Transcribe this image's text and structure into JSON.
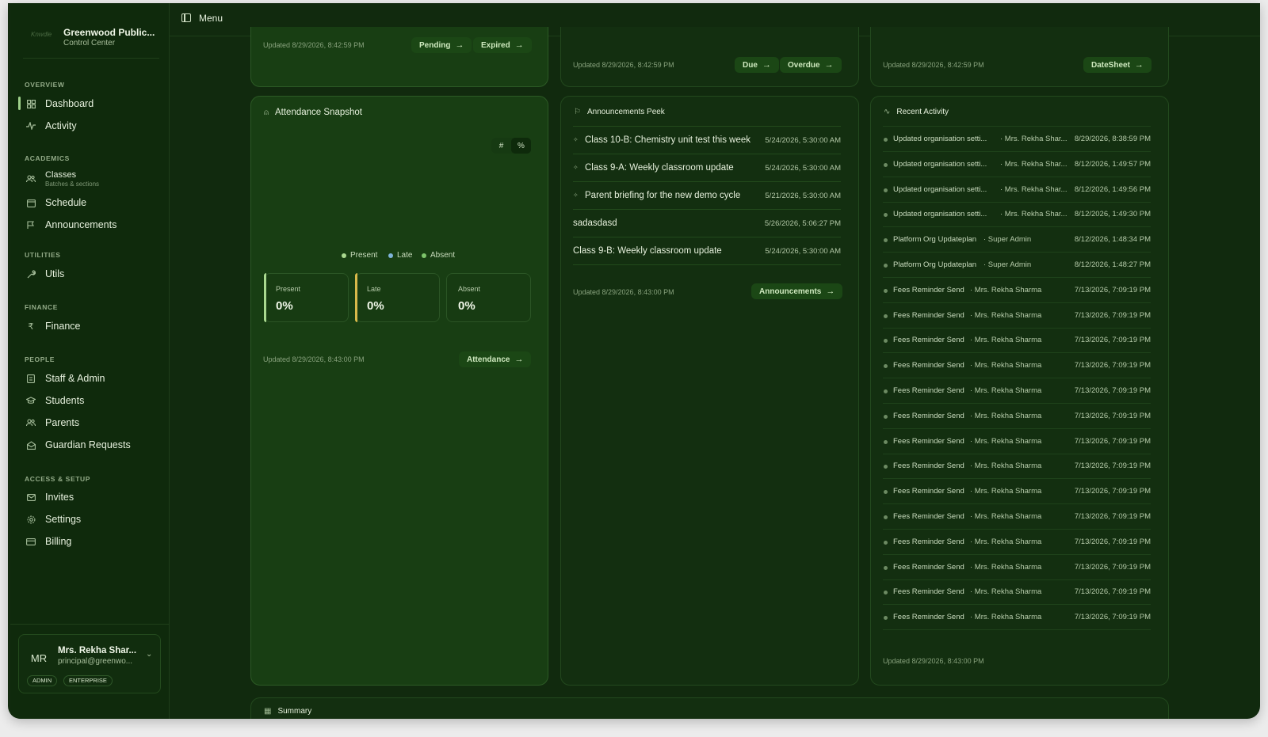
{
  "brand": {
    "logo_text": "Knwdle",
    "name": "Greenwood Public...",
    "subtitle": "Control Center"
  },
  "topbar": {
    "menu_label": "Menu"
  },
  "sidebar": {
    "sections": {
      "overview": "OVERVIEW",
      "academics": "ACADEMICS",
      "utilities": "UTILITIES",
      "finance": "FINANCE",
      "people": "PEOPLE",
      "access": "ACCESS & SETUP"
    },
    "items": {
      "dashboard": "Dashboard",
      "activity": "Activity",
      "classes": "Classes",
      "classes_sub": "Batches & sections",
      "schedule": "Schedule",
      "announcements": "Announcements",
      "utils": "Utils",
      "finance": "Finance",
      "staff": "Staff & Admin",
      "students": "Students",
      "parents": "Parents",
      "guardian": "Guardian Requests",
      "invites": "Invites",
      "settings": "Settings",
      "billing": "Billing"
    },
    "user": {
      "initials": "MR",
      "name": "Mrs. Rekha Shar...",
      "email": "principal@greenwo...",
      "badge_role": "ADMIN",
      "badge_plan": "ENTERPRISE"
    }
  },
  "top_cards": [
    {
      "updated": "Updated 8/29/2026, 8:42:59 PM",
      "links": [
        "Pending",
        "Expired"
      ]
    },
    {
      "updated": "Updated 8/29/2026, 8:42:59 PM",
      "links": [
        "Due",
        "Overdue"
      ]
    },
    {
      "updated": "Updated 8/29/2026, 8:42:59 PM",
      "links": [
        "DateSheet"
      ]
    }
  ],
  "attendance": {
    "title": "Attendance Snapshot",
    "toggle": [
      "#",
      "%"
    ],
    "legend": [
      "Present",
      "Late",
      "Absent"
    ],
    "stats": [
      {
        "label": "Present",
        "value": "0%"
      },
      {
        "label": "Late",
        "value": "0%"
      },
      {
        "label": "Absent",
        "value": "0%"
      }
    ],
    "updated": "Updated 8/29/2026, 8:43:00 PM",
    "link": "Attendance",
    "colors": {
      "present": "#a9d88f",
      "late": "#7fb3d8",
      "absent": "#7dc46a"
    }
  },
  "announcements": {
    "title": "Announcements Peek",
    "items": [
      {
        "title": "Class 10-B: Chemistry unit test this week",
        "date": "5/24/2026, 5:30:00 AM",
        "pinned": true
      },
      {
        "title": "Class 9-A: Weekly classroom update",
        "date": "5/24/2026, 5:30:00 AM",
        "pinned": true
      },
      {
        "title": "Parent briefing for the new demo cycle",
        "date": "5/21/2026, 5:30:00 AM",
        "pinned": true
      },
      {
        "title": "sadasdasd",
        "date": "5/26/2026, 5:06:27 PM",
        "pinned": false
      },
      {
        "title": "Class 9-B: Weekly classroom update",
        "date": "5/24/2026, 5:30:00 AM",
        "pinned": false
      }
    ],
    "updated": "Updated 8/29/2026, 8:43:00 PM",
    "link": "Announcements"
  },
  "activity": {
    "title": "Recent Activity",
    "items": [
      {
        "title": "Updated organisation setti...",
        "by": "· Mrs. Rekha Shar...",
        "time": "8/29/2026, 8:38:59 PM"
      },
      {
        "title": "Updated organisation setti...",
        "by": "· Mrs. Rekha Shar...",
        "time": "8/12/2026, 1:49:57 PM"
      },
      {
        "title": "Updated organisation setti...",
        "by": "· Mrs. Rekha Shar...",
        "time": "8/12/2026, 1:49:56 PM"
      },
      {
        "title": "Updated organisation setti...",
        "by": "· Mrs. Rekha Shar...",
        "time": "8/12/2026, 1:49:30 PM"
      },
      {
        "title": "Platform Org Updateplan",
        "by": "· Super Admin",
        "time": "8/12/2026, 1:48:34 PM"
      },
      {
        "title": "Platform Org Updateplan",
        "by": "· Super Admin",
        "time": "8/12/2026, 1:48:27 PM"
      },
      {
        "title": "Fees Reminder Send",
        "by": "· Mrs. Rekha Sharma",
        "time": "7/13/2026, 7:09:19 PM"
      },
      {
        "title": "Fees Reminder Send",
        "by": "· Mrs. Rekha Sharma",
        "time": "7/13/2026, 7:09:19 PM"
      },
      {
        "title": "Fees Reminder Send",
        "by": "· Mrs. Rekha Sharma",
        "time": "7/13/2026, 7:09:19 PM"
      },
      {
        "title": "Fees Reminder Send",
        "by": "· Mrs. Rekha Sharma",
        "time": "7/13/2026, 7:09:19 PM"
      },
      {
        "title": "Fees Reminder Send",
        "by": "· Mrs. Rekha Sharma",
        "time": "7/13/2026, 7:09:19 PM"
      },
      {
        "title": "Fees Reminder Send",
        "by": "· Mrs. Rekha Sharma",
        "time": "7/13/2026, 7:09:19 PM"
      },
      {
        "title": "Fees Reminder Send",
        "by": "· Mrs. Rekha Sharma",
        "time": "7/13/2026, 7:09:19 PM"
      },
      {
        "title": "Fees Reminder Send",
        "by": "· Mrs. Rekha Sharma",
        "time": "7/13/2026, 7:09:19 PM"
      },
      {
        "title": "Fees Reminder Send",
        "by": "· Mrs. Rekha Sharma",
        "time": "7/13/2026, 7:09:19 PM"
      },
      {
        "title": "Fees Reminder Send",
        "by": "· Mrs. Rekha Sharma",
        "time": "7/13/2026, 7:09:19 PM"
      },
      {
        "title": "Fees Reminder Send",
        "by": "· Mrs. Rekha Sharma",
        "time": "7/13/2026, 7:09:19 PM"
      },
      {
        "title": "Fees Reminder Send",
        "by": "· Mrs. Rekha Sharma",
        "time": "7/13/2026, 7:09:19 PM"
      },
      {
        "title": "Fees Reminder Send",
        "by": "· Mrs. Rekha Sharma",
        "time": "7/13/2026, 7:09:19 PM"
      },
      {
        "title": "Fees Reminder Send",
        "by": "· Mrs. Rekha Sharma",
        "time": "7/13/2026, 7:09:19 PM"
      }
    ],
    "updated": "Updated 8/29/2026, 8:43:00 PM"
  },
  "summary": {
    "title": "Summary"
  },
  "icons": {
    "menu": "sidebar-toggle-icon",
    "dashboard": "grid-icon",
    "activity": "pulse-icon",
    "classes": "users-icon",
    "schedule": "calendar-icon",
    "announcements": "flag-icon",
    "utils": "wrench-icon",
    "finance": "rupee-icon",
    "staff": "id-card-icon",
    "students": "graduation-cap-icon",
    "parents": "users-icon",
    "guardian": "mail-open-icon",
    "invites": "mail-icon",
    "settings": "gear-icon",
    "billing": "credit-card-icon"
  }
}
